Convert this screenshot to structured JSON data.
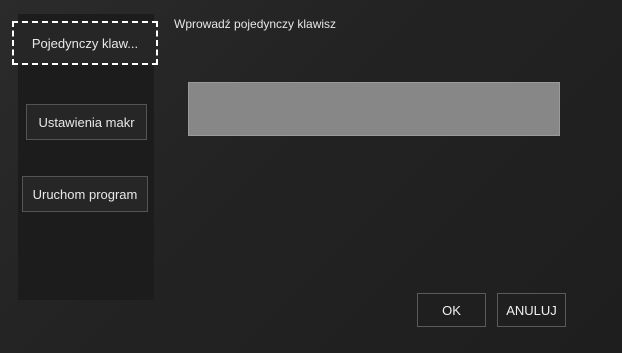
{
  "sidebar": {
    "items": [
      {
        "label": "Pojedynczy klaw...",
        "active": true
      },
      {
        "label": "Ustawienia makr",
        "active": false
      },
      {
        "label": "Uruchom program",
        "active": false
      }
    ]
  },
  "main": {
    "title": "Wprowadź pojedynczy klawisz",
    "key_input_value": ""
  },
  "footer": {
    "ok_label": "OK",
    "cancel_label": "ANULUJ"
  },
  "colors": {
    "background": "#232323",
    "input_fill": "#878787",
    "focus_outline": "#ffffff"
  }
}
